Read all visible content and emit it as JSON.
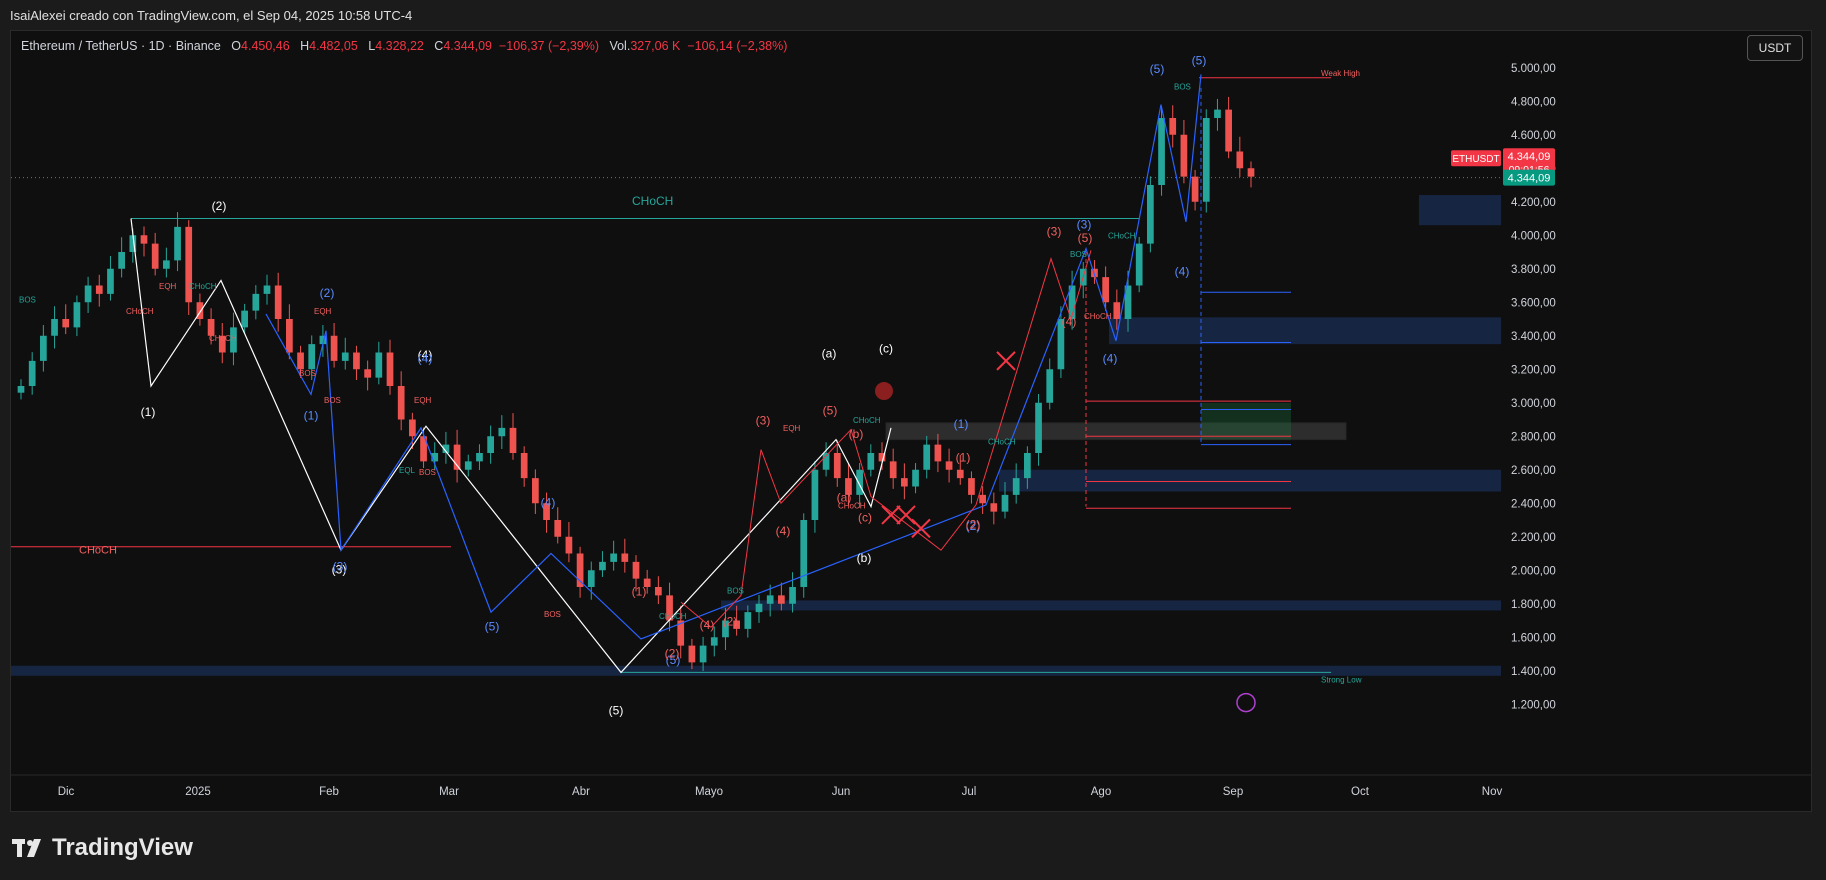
{
  "caption": "IsaiAlexei creado con TradingView.com, el Sep 04, 2025 10:58 UTC-4",
  "footer_brand": "TradingView",
  "header": {
    "symbol": "Ethereum / TetherUS · 1D · Binance",
    "o_label": "O",
    "o_value": "4.450,46",
    "h_label": "H",
    "h_value": "4.482,05",
    "l_label": "L",
    "l_value": "4.328,22",
    "c_label": "C",
    "c_value": "4.344,09",
    "change": "−106,37 (−2,39%)",
    "vol_label": "Vol.",
    "vol_value": "327,06 K",
    "vol_change": "−106,14 (−2,38%)"
  },
  "currency_button": "USDT",
  "colors": {
    "bg": "#0f0f0f",
    "up": "#26a69a",
    "down": "#ef5350",
    "zone": "#1e3a6e",
    "blue": "#2962ff",
    "white": "#ffffff",
    "red_line": "#f23645",
    "teal": "#26a69a"
  },
  "chart_data": {
    "type": "candlestick",
    "symbol": "ETHUSDT",
    "y_ticks": [
      "5.000,00",
      "4.800,00",
      "4.600,00",
      "4.400,00",
      "4.200,00",
      "4.000,00",
      "3.800,00",
      "3.600,00",
      "3.400,00",
      "3.200,00",
      "3.000,00",
      "2.800,00",
      "2.600,00",
      "2.400,00",
      "2.200,00",
      "2.000,00",
      "1.800,00",
      "1.600,00",
      "1.400,00",
      "1.200,00"
    ],
    "y_tick_values": [
      5000,
      4800,
      4600,
      4400,
      4200,
      4000,
      3800,
      3600,
      3400,
      3200,
      3000,
      2800,
      2600,
      2400,
      2200,
      2000,
      1800,
      1600,
      1400,
      1200
    ],
    "x_ticks": [
      "Dic",
      "2025",
      "Feb",
      "Mar",
      "Abr",
      "Mayo",
      "Jun",
      "Jul",
      "Ago",
      "Sep",
      "Oct",
      "Nov"
    ],
    "ylim": [
      1100,
      5100
    ],
    "price_badge": {
      "name": "ETHUSDT",
      "price": "4.344,09",
      "countdown": "09:01:56"
    },
    "current_label": "4.344,09",
    "current_price": 4344,
    "closes": [
      3100,
      3250,
      3400,
      3500,
      3450,
      3600,
      3700,
      3650,
      3800,
      3900,
      4000,
      3950,
      3800,
      3850,
      4050,
      3600,
      3500,
      3400,
      3300,
      3450,
      3550,
      3650,
      3700,
      3500,
      3300,
      3200,
      3350,
      3400,
      3250,
      3300,
      3200,
      3150,
      3300,
      3100,
      2900,
      2800,
      2650,
      2700,
      2750,
      2600,
      2650,
      2700,
      2800,
      2850,
      2700,
      2550,
      2400,
      2300,
      2200,
      2100,
      1900,
      2000,
      2050,
      2100,
      2050,
      1950,
      1900,
      1850,
      1700,
      1550,
      1450,
      1550,
      1600,
      1700,
      1650,
      1750,
      1800,
      1850,
      1800,
      1900,
      2300,
      2600,
      2700,
      2550,
      2450,
      2600,
      2700,
      2650,
      2550,
      2500,
      2600,
      2750,
      2650,
      2600,
      2550,
      2450,
      2400,
      2350,
      2450,
      2550,
      2700,
      3000,
      3200,
      3500,
      3700,
      3800,
      3750,
      3600,
      3500,
      3700,
      3950,
      4300,
      4700,
      4600,
      4350,
      4200,
      4700,
      4750,
      4500,
      4400,
      4350
    ],
    "wave_labels": [
      {
        "text": "(2)",
        "color": "white"
      },
      {
        "text": "(1)",
        "color": "white"
      },
      {
        "text": "(4)",
        "color": "white"
      },
      {
        "text": "(3)",
        "color": "white"
      },
      {
        "text": "(5)",
        "color": "white"
      },
      {
        "text": "(a)",
        "color": "white"
      },
      {
        "text": "(c)",
        "color": "white"
      },
      {
        "text": "(b)",
        "color": "white"
      },
      {
        "text": "(2)",
        "color": "blue"
      },
      {
        "text": "(1)",
        "color": "blue"
      },
      {
        "text": "(3)",
        "color": "blue"
      },
      {
        "text": "(4)",
        "color": "blue"
      },
      {
        "text": "(5)",
        "color": "blue"
      },
      {
        "text": "(5)",
        "color": "blue"
      },
      {
        "text": "(5)",
        "color": "blue"
      },
      {
        "text": "(3)",
        "color": "blue"
      },
      {
        "text": "(4)",
        "color": "blue"
      },
      {
        "text": "(4)",
        "color": "blue"
      },
      {
        "text": "(1)",
        "color": "blue"
      },
      {
        "text": "(2)",
        "color": "blue"
      },
      {
        "text": "(4)",
        "color": "blue"
      },
      {
        "text": "(5)",
        "color": "blue"
      },
      {
        "text": "(3)",
        "color": "red"
      },
      {
        "text": "(5)",
        "color": "red"
      },
      {
        "text": "(b)",
        "color": "red"
      },
      {
        "text": "(4)",
        "color": "red"
      },
      {
        "text": "(a)",
        "color": "red"
      },
      {
        "text": "(c)",
        "color": "red"
      },
      {
        "text": "(1)",
        "color": "red"
      },
      {
        "text": "(2)",
        "color": "red"
      },
      {
        "text": "(4)",
        "color": "red"
      },
      {
        "text": "(2)",
        "color": "red"
      },
      {
        "text": "(3)",
        "color": "red"
      },
      {
        "text": "(5)",
        "color": "red"
      },
      {
        "text": "(4)",
        "color": "red"
      },
      {
        "text": "(1)",
        "color": "red"
      },
      {
        "text": "(2)",
        "color": "red"
      }
    ],
    "annotations": [
      {
        "text": "CHoCH",
        "color": "teal"
      },
      {
        "text": "CHoCH",
        "color": "red"
      },
      {
        "text": "Weak High",
        "color": "red"
      },
      {
        "text": "Strong Low",
        "color": "teal"
      },
      {
        "text": "BOS",
        "color": "teal"
      },
      {
        "text": "EQH",
        "color": "red"
      },
      {
        "text": "CHoCH",
        "color": "teal"
      },
      {
        "text": "CHoCH",
        "color": "red"
      },
      {
        "text": "CHoCH",
        "color": "red"
      },
      {
        "text": "EQH",
        "color": "red"
      },
      {
        "text": "BOS",
        "color": "red"
      },
      {
        "text": "BOS",
        "color": "red"
      },
      {
        "text": "EQH",
        "color": "red"
      },
      {
        "text": "BOS",
        "color": "red"
      },
      {
        "text": "EQL",
        "color": "teal"
      },
      {
        "text": "BOS",
        "color": "red"
      },
      {
        "text": "CHoCH",
        "color": "teal"
      },
      {
        "text": "BOS",
        "color": "teal"
      },
      {
        "text": "EQH",
        "color": "red"
      },
      {
        "text": "CHoCH",
        "color": "teal"
      },
      {
        "text": "CHoCH",
        "color": "red"
      },
      {
        "text": "CHoCH",
        "color": "teal"
      },
      {
        "text": "BOS",
        "color": "teal"
      },
      {
        "text": "CHoCH",
        "color": "red"
      },
      {
        "text": "CHoCH",
        "color": "teal"
      },
      {
        "text": "BOS",
        "color": "teal"
      }
    ]
  }
}
